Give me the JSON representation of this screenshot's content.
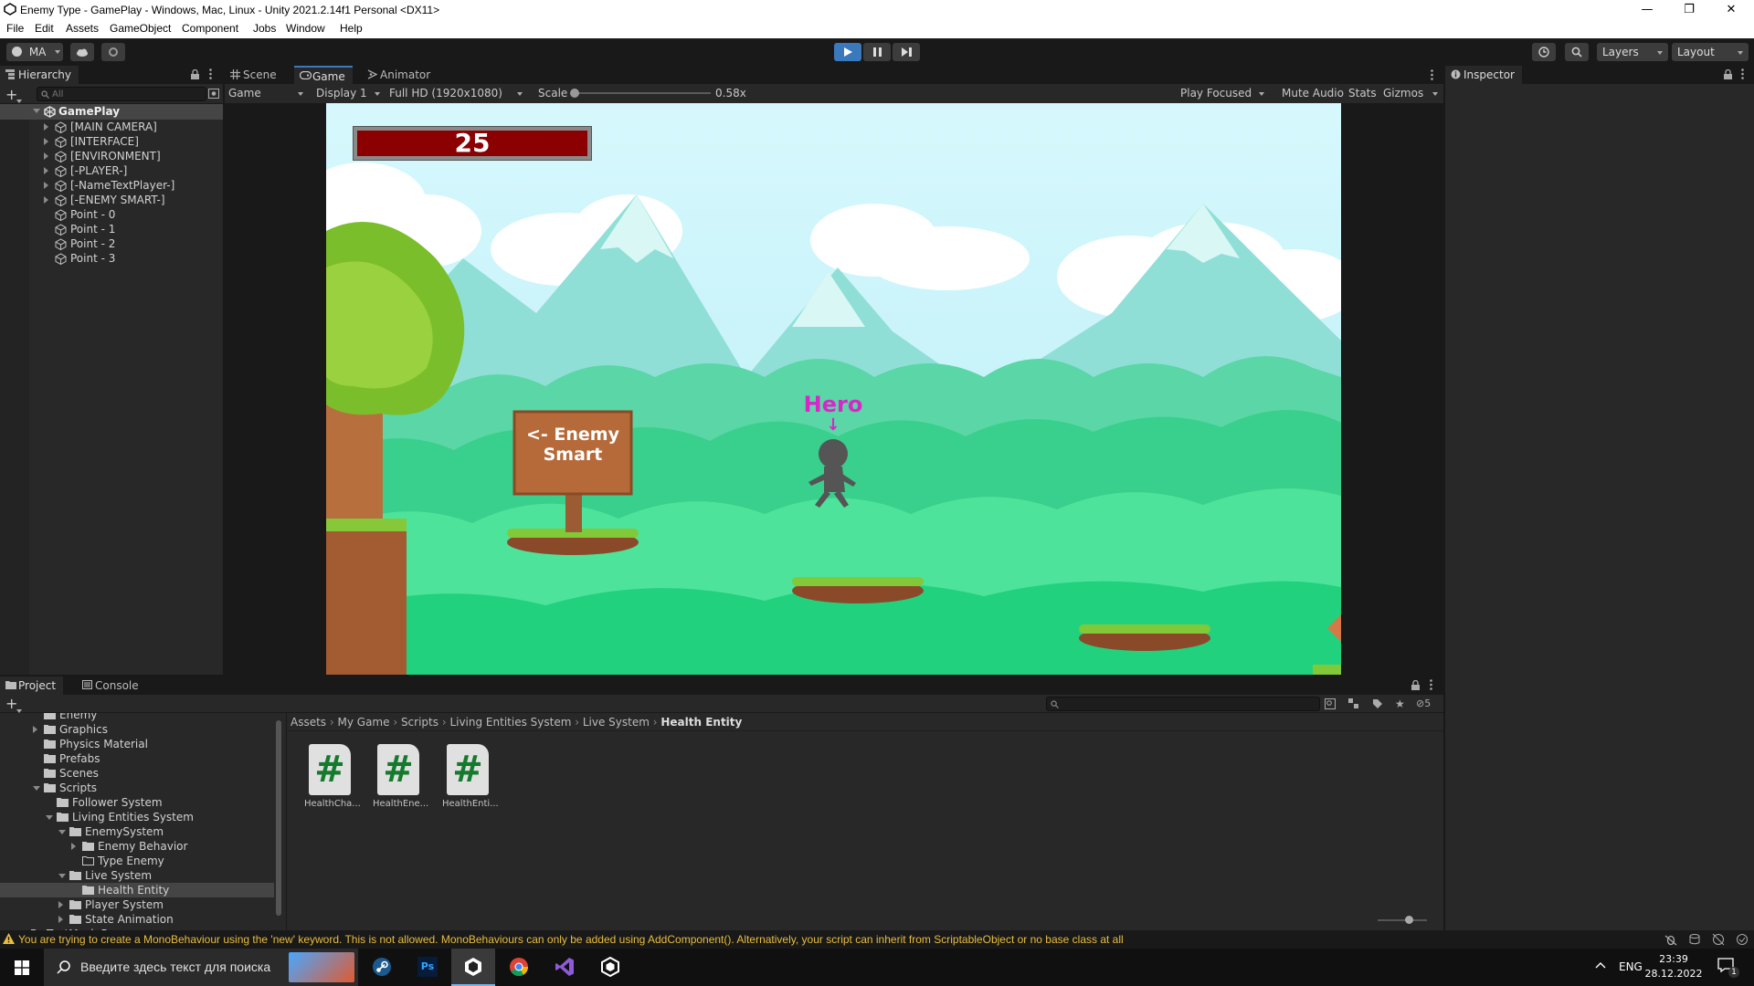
{
  "window": {
    "title": "Enemy Type - GamePlay - Windows, Mac, Linux - Unity 2021.2.14f1 Personal <DX11>",
    "minimize": "—",
    "restore": "❐",
    "close": "✕"
  },
  "menu": [
    "File",
    "Edit",
    "Assets",
    "GameObject",
    "Component",
    "Jobs",
    "Window",
    "Help"
  ],
  "toolbar": {
    "account": "MA",
    "layers_label": "Layers",
    "layout_label": "Layout"
  },
  "hierarchy": {
    "tab": "Hierarchy",
    "search_placeholder": "All",
    "scene": "GamePlay",
    "items": [
      "[MAIN CAMERA]",
      "[INTERFACE]",
      "[ENVIRONMENT]",
      "[-PLAYER-]",
      "[-NameTextPlayer-]",
      "[-ENEMY SMART-]",
      "Point - 0",
      "Point - 1",
      "Point - 2",
      "Point - 3"
    ]
  },
  "center": {
    "tabs": [
      "Scene",
      "Game",
      "Animator"
    ],
    "game_toolbar": {
      "view": "Game",
      "display": "Display 1",
      "resolution": "Full HD (1920x1080)",
      "scale_label": "Scale",
      "scale_value": "0.58x",
      "play_focused": "Play Focused",
      "mute": "Mute Audio",
      "stats": "Stats",
      "gizmos": "Gizmos"
    }
  },
  "game": {
    "health_value": "25",
    "sign_text_1": "<- Enemy",
    "sign_text_2": "Smart",
    "hero_label": "Hero",
    "hero_arrow": "↓"
  },
  "inspector": {
    "tab": "Inspector"
  },
  "project": {
    "tabs": [
      "Project",
      "Console"
    ],
    "tree": [
      {
        "label": "Enemy",
        "indent": 2,
        "type": "folder",
        "arrow": "none"
      },
      {
        "label": "Graphics",
        "indent": 2,
        "type": "folder",
        "arrow": "right"
      },
      {
        "label": "Physics Material",
        "indent": 2,
        "type": "folder",
        "arrow": "none"
      },
      {
        "label": "Prefabs",
        "indent": 2,
        "type": "folder",
        "arrow": "none"
      },
      {
        "label": "Scenes",
        "indent": 2,
        "type": "folder",
        "arrow": "none"
      },
      {
        "label": "Scripts",
        "indent": 2,
        "type": "folder",
        "arrow": "down"
      },
      {
        "label": "Follower System",
        "indent": 3,
        "type": "folder",
        "arrow": "none"
      },
      {
        "label": "Living Entities System",
        "indent": 3,
        "type": "folder",
        "arrow": "down"
      },
      {
        "label": "EnemySystem",
        "indent": 4,
        "type": "folder",
        "arrow": "down"
      },
      {
        "label": "Enemy Behavior",
        "indent": 5,
        "type": "folder",
        "arrow": "right"
      },
      {
        "label": "Type Enemy",
        "indent": 5,
        "type": "folder-empty",
        "arrow": "none"
      },
      {
        "label": "Live System",
        "indent": 4,
        "type": "folder",
        "arrow": "down"
      },
      {
        "label": "Health Entity",
        "indent": 5,
        "type": "folder",
        "arrow": "none",
        "selected": true
      },
      {
        "label": "Player System",
        "indent": 4,
        "type": "folder",
        "arrow": "right"
      },
      {
        "label": "State Animation",
        "indent": 4,
        "type": "folder",
        "arrow": "right"
      },
      {
        "label": "TextMesh Pro",
        "indent": 1,
        "type": "folder",
        "arrow": "right"
      }
    ],
    "breadcrumb": [
      "Assets",
      "My Game",
      "Scripts",
      "Living Entities System",
      "Live System",
      "Health Entity"
    ],
    "assets": [
      {
        "symbol": "#",
        "name": "HealthCha..."
      },
      {
        "symbol": "#",
        "name": "HealthEne..."
      },
      {
        "symbol": "#",
        "name": "HealthEnti..."
      }
    ],
    "hidden_count": "5"
  },
  "status": {
    "message": "You are trying to create a MonoBehaviour using the 'new' keyword.  This is not allowed.  MonoBehaviours can only be added using AddComponent(). Alternatively, your script can inherit from ScriptableObject or no base class at all"
  },
  "taskbar": {
    "search_placeholder": "Введите здесь текст для поиска",
    "lang": "ENG",
    "time": "23:39",
    "date": "28.12.2022",
    "notification_count": "1"
  },
  "colors": {
    "accent_selected": "#2c5d87",
    "play_active": "#3a79bb",
    "health_bar": "#8b0000",
    "hero_label": "#d827c8",
    "warning": "#e8bd3e"
  }
}
